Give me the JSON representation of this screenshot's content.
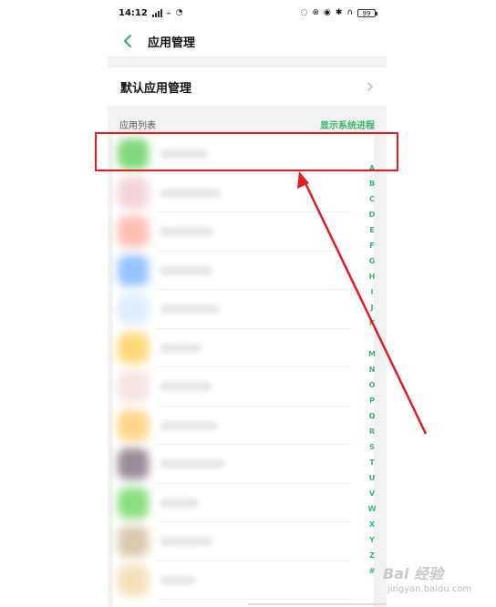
{
  "status_bar": {
    "time": "14:12",
    "battery": "99"
  },
  "header": {
    "title": "应用管理"
  },
  "default_apps": {
    "label": "默认应用管理"
  },
  "section": {
    "list_label": "应用列表",
    "show_system_label": "显示系统进程"
  },
  "alphabet": [
    "A",
    "B",
    "C",
    "D",
    "E",
    "F",
    "G",
    "H",
    "I",
    "J",
    "K",
    "",
    "M",
    "N",
    "O",
    "P",
    "Q",
    "R",
    "S",
    "T",
    "U",
    "V",
    "W",
    "X",
    "Y",
    "Z",
    "#"
  ],
  "colors": {
    "accent_green": "#38b46a",
    "annotation_red": "#e31b23"
  },
  "icons": {
    "back": "chevron-left-icon",
    "chevron": "chevron-right-icon"
  },
  "apps": [
    {
      "color": "#72d36d",
      "name_width": 54
    },
    {
      "color": "#f2cfd4",
      "name_width": 68
    },
    {
      "color": "#ffb7aa",
      "name_width": 60
    },
    {
      "color": "#8cbcff",
      "name_width": 58
    },
    {
      "color": "#dcecff",
      "name_width": 66
    },
    {
      "color": "#ffd56b",
      "name_width": 46
    },
    {
      "color": "#f7e0df",
      "name_width": 58
    },
    {
      "color": "#ffd27f",
      "name_width": 64
    },
    {
      "color": "#8f7f8d",
      "name_width": 72
    },
    {
      "color": "#7edb73",
      "name_width": 44
    },
    {
      "color": "#d8c5a5",
      "name_width": 58
    },
    {
      "color": "#f5ddb4",
      "name_width": 40
    }
  ],
  "watermark": {
    "brand": "Bai 经验",
    "domain": "jingyan.baidu.com"
  }
}
